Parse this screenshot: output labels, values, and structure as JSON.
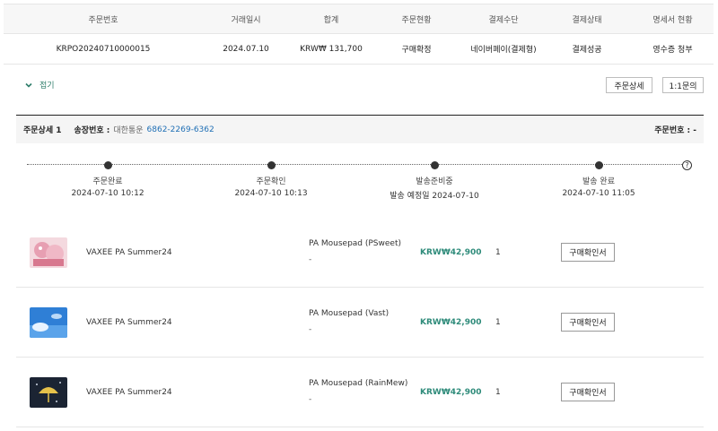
{
  "order_table": {
    "headers": [
      "주문번호",
      "거래일시",
      "합계",
      "주문현황",
      "결제수단",
      "결제상태",
      "명세서 현황"
    ],
    "row": {
      "order_no": "KRPO20240710000015",
      "date": "2024.07.10",
      "total": "KRW₩ 131,700",
      "status": "구매확정",
      "payment_method": "네이버페이(결제형)",
      "payment_status": "결제성공",
      "receipt": "영수증 청부"
    }
  },
  "controls": {
    "fold_label": "접기",
    "order_detail_button": "주문상세",
    "inquiry_button": "1:1문의"
  },
  "detail": {
    "title": "주문상세 1",
    "shipping_label": "송장번호 :",
    "carrier": "대한통운",
    "tracking_no": "6862-2269-6362",
    "order_no_label": "주문번호 : -"
  },
  "timeline": {
    "stages": [
      {
        "label": "주문완료",
        "date": "2024-07-10 10:12"
      },
      {
        "label": "주문확인",
        "date": "2024-07-10 10:13"
      },
      {
        "label": "발송준비중",
        "date": "발송 예정일 2024-07-10"
      },
      {
        "label": "발송 완료",
        "date": "2024-07-10 11:05"
      }
    ],
    "help": "?"
  },
  "items": [
    {
      "product": "VAXEE PA Summer24",
      "variant": "PA Mousepad (PSweet)",
      "variant_sub": "-",
      "price": "KRW₩42,900",
      "qty": "1",
      "button": "구매확인서",
      "thumb_icon": "pink-character-thumbnail"
    },
    {
      "product": "VAXEE PA Summer24",
      "variant": "PA Mousepad (Vast)",
      "variant_sub": "-",
      "price": "KRW₩42,900",
      "qty": "1",
      "button": "구매확인서",
      "thumb_icon": "blue-sky-thumbnail"
    },
    {
      "product": "VAXEE PA Summer24",
      "variant": "PA Mousepad (RainMew)",
      "variant_sub": "-",
      "price": "KRW₩42,900",
      "qty": "1",
      "button": "구매확인서",
      "thumb_icon": "night-umbrella-thumbnail"
    }
  ],
  "colors": {
    "accent_green": "#2e8b57",
    "price_teal": "#2e8b7a",
    "link_blue": "#1f6fb5"
  }
}
